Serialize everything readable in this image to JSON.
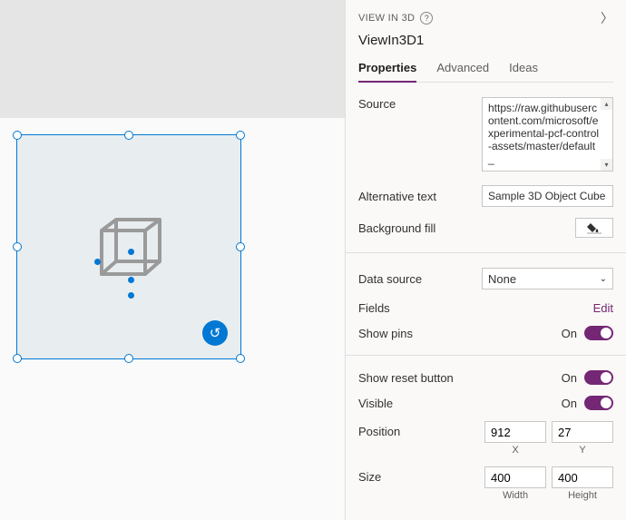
{
  "canvas": {
    "reset_icon": "↺"
  },
  "panel": {
    "type_label": "VIEW IN 3D",
    "control_name": "ViewIn3D1",
    "tabs": {
      "properties": "Properties",
      "advanced": "Advanced",
      "ideas": "Ideas"
    }
  },
  "props": {
    "source_label": "Source",
    "source_value": "https://raw.githubusercontent.com/microsoft/experimental-pcf-control-assets/master/default_",
    "alt_text_label": "Alternative text",
    "alt_text_value": "Sample 3D Object Cube",
    "bgfill_label": "Background fill",
    "datasource_label": "Data source",
    "datasource_value": "None",
    "fields_label": "Fields",
    "fields_edit": "Edit",
    "showpins_label": "Show pins",
    "showpins_state": "On",
    "showreset_label": "Show reset button",
    "showreset_state": "On",
    "visible_label": "Visible",
    "visible_state": "On",
    "position_label": "Position",
    "position_x": "912",
    "position_y": "27",
    "position_x_label": "X",
    "position_y_label": "Y",
    "size_label": "Size",
    "size_w": "400",
    "size_h": "400",
    "size_w_label": "Width",
    "size_h_label": "Height"
  }
}
